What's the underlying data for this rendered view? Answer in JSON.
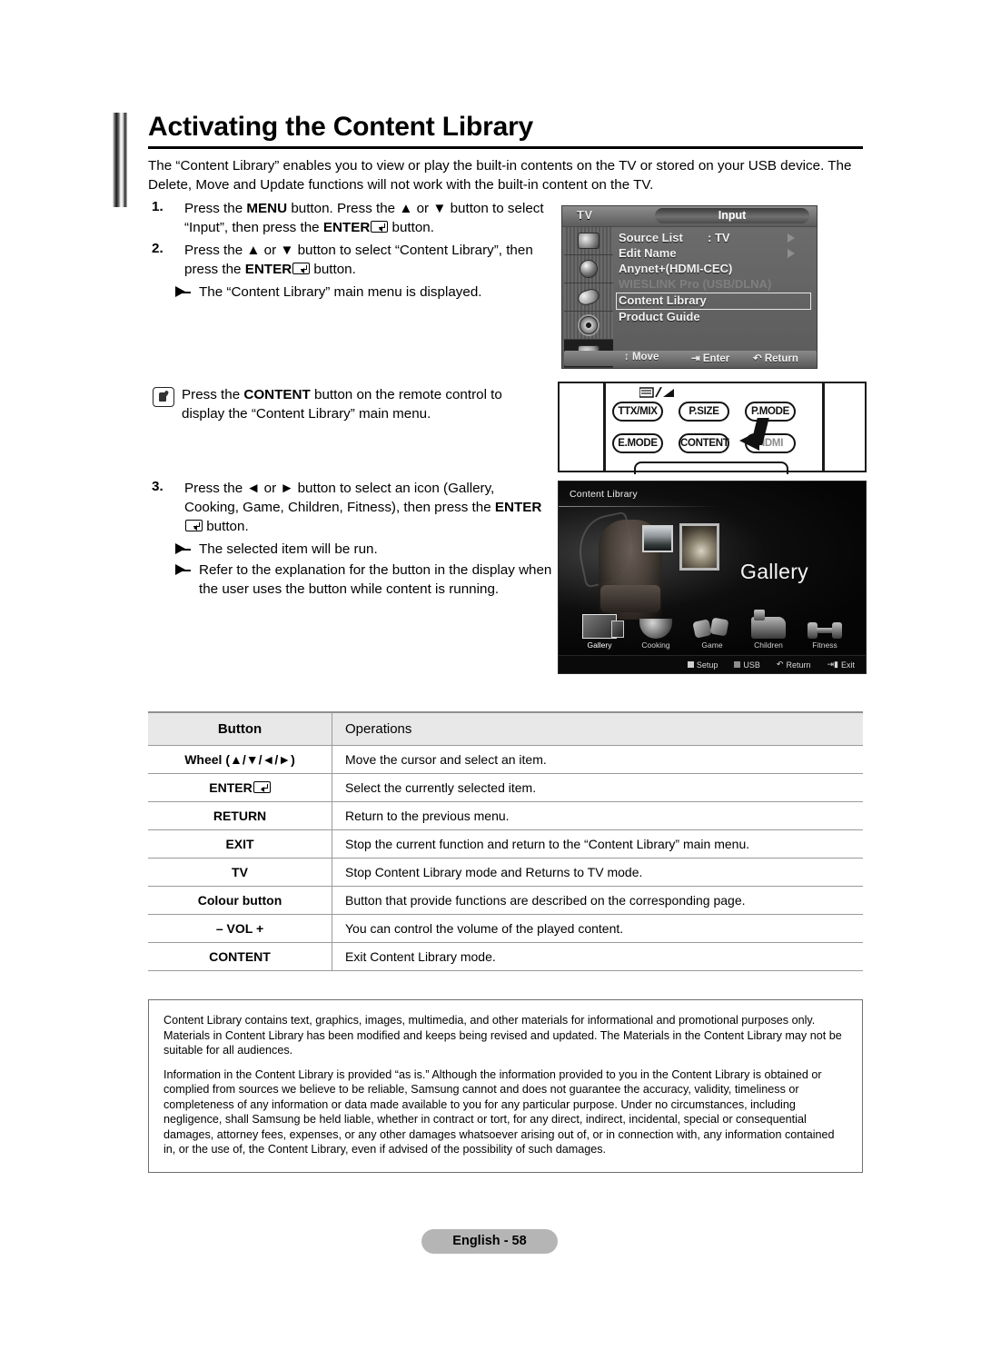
{
  "page": {
    "title": "Activating the Content Library",
    "intro": "The “Content Library” enables you to view or play the built-in contents on the TV or stored on your USB device. The Delete, Move and Update functions will not work with the built-in content on the TV.",
    "footer_label": "English - 58"
  },
  "steps": [
    {
      "num": "1.",
      "text_a": "Press the ",
      "bold_a": "MENU",
      "text_b": " button. Press the ▲ or ▼ button to select “Input”, then press the ",
      "bold_b": "ENTER",
      "text_c": " button."
    },
    {
      "num": "2.",
      "text_a": "Press the ▲ or ▼ button to select “Content Library”, then press the ",
      "bold_b": "ENTER",
      "text_c": " button.",
      "sub": [
        "The “Content Library” main menu is displayed."
      ]
    },
    {
      "num": "3.",
      "text_a": "Press the ◄ or ► button to select an icon (Gallery, Cooking, Game, Children, Fitness), then press the ",
      "bold_b": "ENTER",
      "text_c": " button.",
      "sub": [
        "The selected item will be run.",
        "Refer to the explanation for the button in the display when the user uses the button while content is running."
      ]
    }
  ],
  "content_note": {
    "text_a": "Press the ",
    "bold": "CONTENT",
    "text_b": " button on the remote control to display the “Content Library” main menu."
  },
  "tv_menu": {
    "source_label": "TV",
    "header": "Input",
    "rows": [
      {
        "label": "Source List",
        "value": ": TV",
        "arrow": true,
        "dim": false,
        "selected": false
      },
      {
        "label": "Edit Name",
        "value": "",
        "arrow": true,
        "dim": false,
        "selected": false
      },
      {
        "label": "Anynet+(HDMI-CEC)",
        "value": "",
        "arrow": false,
        "dim": false,
        "selected": false
      },
      {
        "label": "WIESLINK Pro (USB/DLNA)",
        "value": "",
        "arrow": false,
        "dim": true,
        "selected": false
      },
      {
        "label": "Content Library",
        "value": "",
        "arrow": false,
        "dim": false,
        "selected": true
      },
      {
        "label": "Product Guide",
        "value": "",
        "arrow": false,
        "dim": false,
        "selected": false
      }
    ],
    "bottom_bar": [
      "Move",
      "Enter",
      "Return"
    ],
    "sidebar_icons": [
      "picture-icon",
      "sound-icon",
      "channel-icon",
      "setup-icon",
      "input-icon"
    ]
  },
  "remote": {
    "buttons": [
      "TTX/MIX",
      "P.SIZE",
      "P.MODE",
      "E.MODE",
      "CONTENT",
      "HDMI"
    ],
    "teletext_icon": "teletext-icon",
    "pointer_icon": "arrow-pointer-icon"
  },
  "gallery_screen": {
    "header": "Content Library",
    "selected_title": "Gallery",
    "items": [
      {
        "label": "Gallery",
        "icon": "gallery-icon",
        "active": true
      },
      {
        "label": "Cooking",
        "icon": "cooking-icon",
        "active": false
      },
      {
        "label": "Game",
        "icon": "game-icon",
        "active": false
      },
      {
        "label": "Children",
        "icon": "children-icon",
        "active": false
      },
      {
        "label": "Fitness",
        "icon": "fitness-icon",
        "active": false
      }
    ],
    "bottom_bar": [
      "Setup",
      "USB",
      "Return",
      "Exit"
    ]
  },
  "table": {
    "headers": [
      "Button",
      "Operations"
    ],
    "rows": [
      {
        "button": "Wheel (▲/▼/◄/►)",
        "operation": "Move the cursor and select an item."
      },
      {
        "button": "ENTER",
        "operation": "Select the currently selected item.",
        "enter_glyph": true
      },
      {
        "button": "RETURN",
        "operation": "Return to the previous menu."
      },
      {
        "button": "EXIT",
        "operation": "Stop the current function and return to the “Content Library” main menu."
      },
      {
        "button": "TV",
        "operation": "Stop Content Library mode and Returns to TV mode."
      },
      {
        "button": "Colour button",
        "operation": "Button that provide functions are described on the corresponding page."
      },
      {
        "button": "– VOL +",
        "operation": "You can control the volume of the played content."
      },
      {
        "button": "CONTENT",
        "operation": "Exit Content Library mode."
      }
    ]
  },
  "disclaimer": {
    "paragraphs": [
      "Content Library contains text, graphics, images, multimedia, and other materials for informational and promotional purposes only. Materials in Content Library has been modified and keeps being revised and updated.  The Materials in the Content Library may not be suitable for all audiences.",
      "Information in the Content Library is provided “as is.” Although the information provided to you in the Content Library is obtained or complied from sources we believe to be reliable, Samsung cannot and does not guarantee the accuracy, validity, timeliness or completeness of any information or data made available to you for any particular purpose. Under no circumstances, including negligence, shall Samsung be held liable, whether in contract or tort, for any direct, indirect, incidental, special or consequential damages, attorney fees, expenses, or any other damages whatsoever arising out of, or in connection with, any information contained in, or the use of, the Content Library, even if advised of the possibility of such damages."
    ]
  },
  "colors": {
    "accent_rule": "#000000",
    "table_header_bg": "#e8e8e8",
    "table_border": "#9a9a9a",
    "footer_bg": "#b5b5b5"
  }
}
